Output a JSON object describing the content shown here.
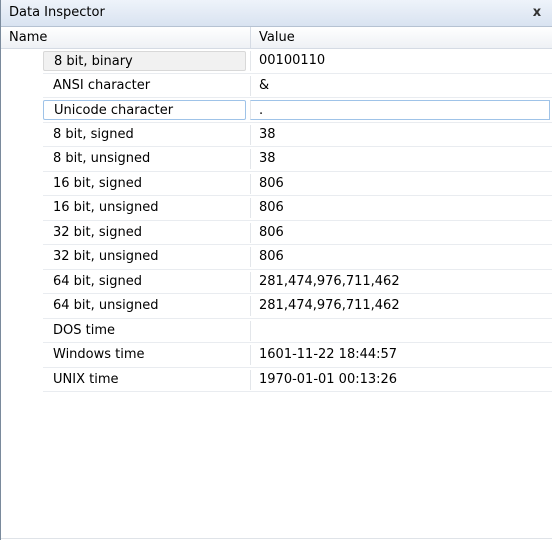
{
  "window": {
    "title": "Data Inspector",
    "close_label": "x"
  },
  "columns": {
    "name": "Name",
    "value": "Value"
  },
  "rows": [
    {
      "name": "8 bit, binary",
      "value": "00100110"
    },
    {
      "name": "ANSI character",
      "value": "&"
    },
    {
      "name": "Unicode character",
      "value": "."
    },
    {
      "name": "8 bit, signed",
      "value": "38"
    },
    {
      "name": "8 bit, unsigned",
      "value": "38"
    },
    {
      "name": "16 bit, signed",
      "value": "806"
    },
    {
      "name": "16 bit, unsigned",
      "value": "806"
    },
    {
      "name": "32 bit, signed",
      "value": "806"
    },
    {
      "name": "32 bit, unsigned",
      "value": "806"
    },
    {
      "name": "64 bit, signed",
      "value": "281,474,976,711,462"
    },
    {
      "name": "64 bit, unsigned",
      "value": "281,474,976,711,462"
    },
    {
      "name": "DOS time",
      "value": ""
    },
    {
      "name": "Windows time",
      "value": "1601-11-22 18:44:57"
    },
    {
      "name": "UNIX time",
      "value": "1970-01-01 00:13:26"
    }
  ]
}
